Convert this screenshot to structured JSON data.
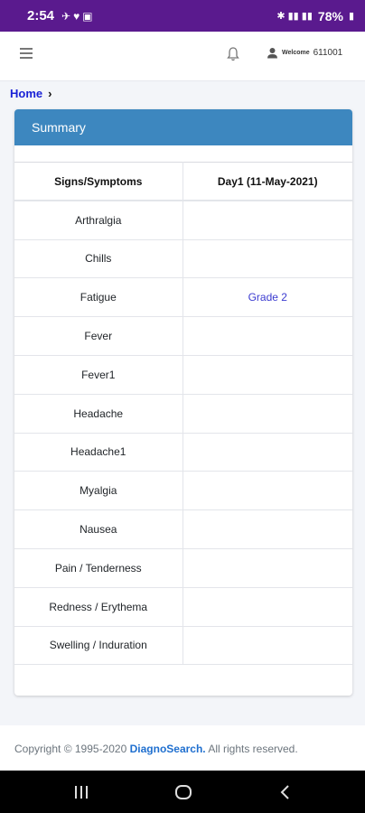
{
  "status_bar": {
    "time": "2:54",
    "battery": "78%"
  },
  "header": {
    "welcome_label": "Welcome",
    "user_id": "611001"
  },
  "breadcrumb": {
    "home": "Home"
  },
  "card": {
    "title": "Summary"
  },
  "table": {
    "headers": [
      "Signs/Symptoms",
      "Day1 (11-May-2021)"
    ],
    "rows": [
      {
        "symptom": "Arthralgia",
        "day1": ""
      },
      {
        "symptom": "Chills",
        "day1": ""
      },
      {
        "symptom": "Fatigue",
        "day1": "Grade 2"
      },
      {
        "symptom": "Fever",
        "day1": ""
      },
      {
        "symptom": "Fever1",
        "day1": ""
      },
      {
        "symptom": "Headache",
        "day1": ""
      },
      {
        "symptom": "Headache1",
        "day1": ""
      },
      {
        "symptom": "Myalgia",
        "day1": ""
      },
      {
        "symptom": "Nausea",
        "day1": ""
      },
      {
        "symptom": "Pain / Tenderness",
        "day1": ""
      },
      {
        "symptom": "Redness / Erythema",
        "day1": ""
      },
      {
        "symptom": "Swelling / Induration",
        "day1": ""
      }
    ]
  },
  "footer": {
    "prefix": "Copyright © 1995-2020",
    "brand": "DiagnoSearch.",
    "suffix": "All rights reserved."
  },
  "colors": {
    "status_bar": "#5a1a8e",
    "card_header": "#3d87bf",
    "link": "#1a22d6",
    "grade": "#3b3bd0",
    "brand": "#1f6fcf"
  },
  "icons": [
    "menu-icon",
    "bell-icon",
    "user-icon",
    "chevron-right-icon",
    "recent-apps-icon",
    "home-nav-icon",
    "back-nav-icon"
  ]
}
